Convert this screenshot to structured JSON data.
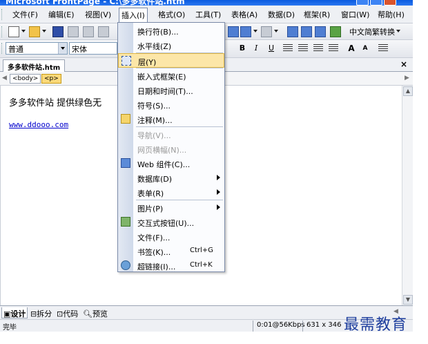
{
  "window": {
    "title": "Microsoft FrontPage - C:\\多多软件站.htm"
  },
  "menubar": {
    "items": [
      "文件(F)",
      "编辑(E)",
      "视图(V)",
      "插入(I)",
      "格式(O)",
      "工具(T)",
      "表格(A)",
      "数据(D)",
      "框架(R)",
      "窗口(W)",
      "帮助(H)"
    ]
  },
  "toolbar": {
    "lang_button": "中文简繁转换"
  },
  "format_bar": {
    "style_value": "普通",
    "font_value": "宋体",
    "bold": "B",
    "italic": "I",
    "underline": "U",
    "grow": "A",
    "shrink": "A"
  },
  "document": {
    "tab_label": "多多软件站.htm",
    "close": "×",
    "tags": [
      "<body>",
      "<p>"
    ],
    "line1": "多多软件站 提供绿色无",
    "link": "www.ddooo.com"
  },
  "insert_menu": {
    "items": [
      {
        "label": "换行符(B)...",
        "shortcut": "",
        "disabled": false,
        "submenu": false,
        "icon": ""
      },
      {
        "label": "水平线(Z)",
        "shortcut": "",
        "disabled": false,
        "submenu": false,
        "icon": ""
      },
      {
        "label": "层(Y)",
        "shortcut": "",
        "disabled": false,
        "submenu": false,
        "icon": "layer-icon"
      },
      {
        "label": "嵌入式框架(E)",
        "shortcut": "",
        "disabled": false,
        "submenu": false,
        "icon": ""
      },
      {
        "label": "日期和时间(T)...",
        "shortcut": "",
        "disabled": false,
        "submenu": false,
        "icon": ""
      },
      {
        "label": "符号(S)...",
        "shortcut": "",
        "disabled": false,
        "submenu": false,
        "icon": ""
      },
      {
        "label": "注释(M)...",
        "shortcut": "",
        "disabled": false,
        "submenu": false,
        "icon": "comment-icon"
      },
      {
        "label": "导航(V)...",
        "shortcut": "",
        "disabled": true,
        "submenu": false,
        "icon": ""
      },
      {
        "label": "网页横幅(N)...",
        "shortcut": "",
        "disabled": true,
        "submenu": false,
        "icon": ""
      },
      {
        "label": "Web 组件(C)...",
        "shortcut": "",
        "disabled": false,
        "submenu": false,
        "icon": "web-component-icon"
      },
      {
        "label": "数据库(D)",
        "shortcut": "",
        "disabled": false,
        "submenu": true,
        "icon": ""
      },
      {
        "label": "表单(R)",
        "shortcut": "",
        "disabled": false,
        "submenu": true,
        "icon": ""
      },
      {
        "label": "图片(P)",
        "shortcut": "",
        "disabled": false,
        "submenu": true,
        "icon": ""
      },
      {
        "label": "交互式按钮(U)...",
        "shortcut": "",
        "disabled": false,
        "submenu": false,
        "icon": "interactive-button-icon"
      },
      {
        "label": "文件(F)...",
        "shortcut": "",
        "disabled": false,
        "submenu": false,
        "icon": ""
      },
      {
        "label": "书签(K)...",
        "shortcut": "Ctrl+G",
        "disabled": false,
        "submenu": false,
        "icon": ""
      },
      {
        "label": "超链接(I)...",
        "shortcut": "Ctrl+K",
        "disabled": false,
        "submenu": false,
        "icon": "hyperlink-icon"
      }
    ]
  },
  "view_tabs": [
    "设计",
    "拆分",
    "代码",
    "预览"
  ],
  "status": {
    "left": "完毕",
    "speed": "0:01@56Kbps",
    "size": "631 x 346"
  },
  "watermark": "最需教育",
  "colors": {
    "menu_highlight": "#fce6a8",
    "link": "#0000cc",
    "title": "#0a5ae0"
  }
}
